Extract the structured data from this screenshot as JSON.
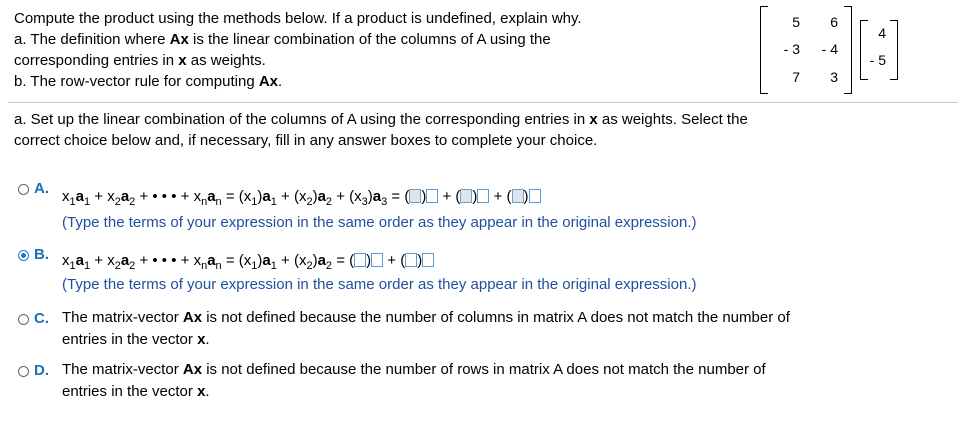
{
  "question": {
    "line1": "Compute the product using the methods below. If a product is undefined, explain why.",
    "line2a": "a. The definition where ",
    "line2b": "Ax",
    "line2c": " is the linear combination of the columns of A using the",
    "line3a": "corresponding entries in ",
    "line3b": "x",
    "line3c": " as weights.",
    "line4a": "b. The row-vector rule for computing ",
    "line4b": "Ax",
    "line4c": "."
  },
  "matrix_A": [
    [
      "5",
      "6"
    ],
    [
      "- 3",
      "- 4"
    ],
    [
      "7",
      "3"
    ]
  ],
  "vector_x": [
    "4",
    "- 5"
  ],
  "part_a": {
    "line1a": "a. Set up the linear combination of the columns of A using the corresponding entries in ",
    "line1b": "x",
    "line1c": " as weights. Select the",
    "line2": "correct choice below and, if necessary, fill in any answer boxes to complete your choice."
  },
  "options": {
    "a": {
      "letter": "A.",
      "hint": "(Type the terms of your expression in the same order as they appear in the original expression.)"
    },
    "b": {
      "letter": "B.",
      "hint": "(Type the terms of your expression in the same order as they appear in the original expression.)"
    },
    "c": {
      "letter": "C.",
      "line1a": "The matrix-vector ",
      "line1b": "Ax",
      "line1c": " is not defined because the number of columns in matrix A does not match the number of",
      "line2a": "entries in the vector ",
      "line2b": "x",
      "line2c": "."
    },
    "d": {
      "letter": "D.",
      "line1a": "The matrix-vector ",
      "line1b": "Ax",
      "line1c": " is not defined because the number of rows in matrix A does not match the number of",
      "line2a": "entries in the vector ",
      "line2b": "x",
      "line2c": "."
    }
  },
  "selected_option": "B"
}
